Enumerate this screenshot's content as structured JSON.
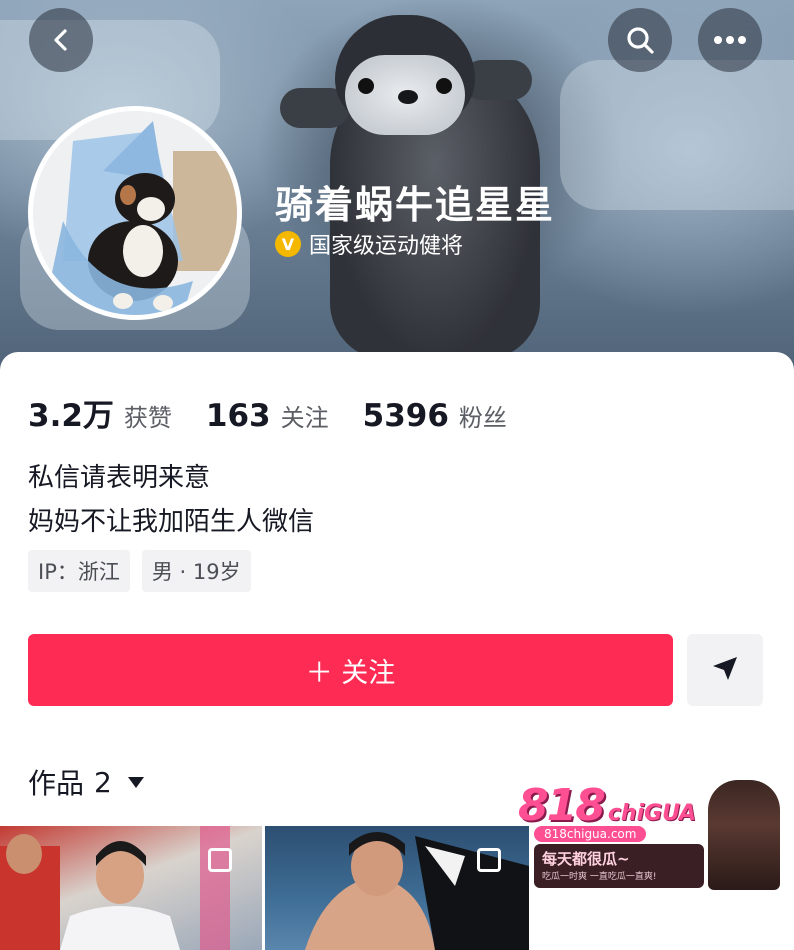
{
  "header": {
    "nickname": "骑着蜗牛追星星",
    "verify_badge": "V",
    "verify_text": "国家级运动健将",
    "icons": [
      "back-icon",
      "search-icon",
      "more-icon"
    ]
  },
  "stats": [
    {
      "value": "3.2万",
      "label": "获赞"
    },
    {
      "value": "163",
      "label": "关注"
    },
    {
      "value": "5396",
      "label": "粉丝"
    }
  ],
  "bio": {
    "line1": "私信请表明来意",
    "line2": "妈妈不让我加陌生人微信"
  },
  "tags": {
    "ip": "IP：浙江",
    "gender_age": "男 · 19岁"
  },
  "actions": {
    "follow_label": "＋ 关注",
    "message_icon": "send-icon"
  },
  "works": {
    "label": "作品",
    "count": "2"
  },
  "ad": {
    "logo_number": "818",
    "logo_brand": "chiGUA",
    "url": "818chigua.com",
    "slogan": "每天都很瓜~",
    "subtext": "吃瓜一时爽 一直吃瓜一直爽!"
  },
  "colors": {
    "accent": "#fe2c55",
    "verify": "#f5b800",
    "text_primary": "#161823",
    "text_secondary": "#5c5e66"
  }
}
